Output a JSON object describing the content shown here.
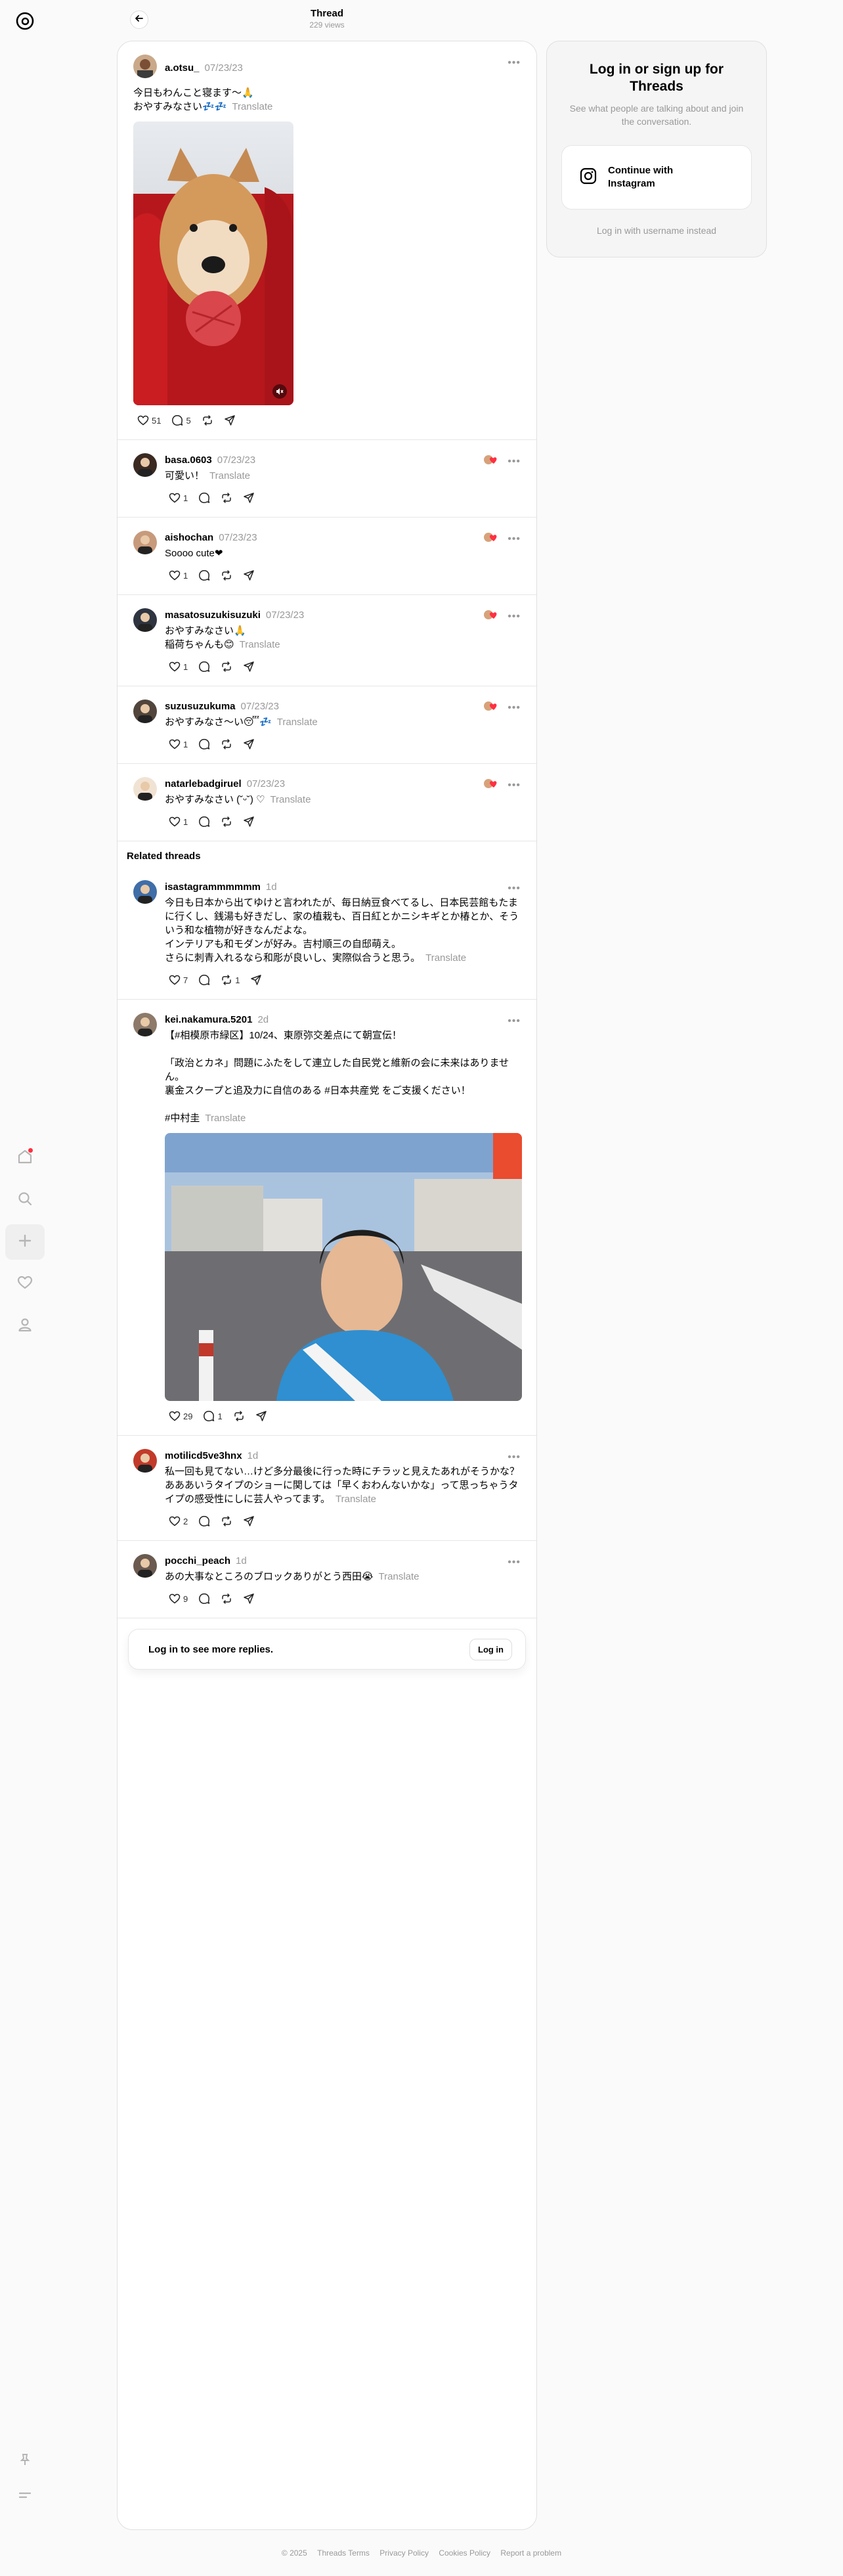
{
  "header": {
    "title": "Thread",
    "views": "229 views"
  },
  "colors": {
    "accent_red": "#ff3040",
    "muted": "#999999",
    "primary_text": "#000000"
  },
  "nav": {
    "icons": [
      "threads-logo-icon",
      "home-icon",
      "search-icon",
      "create-icon",
      "heart-icon",
      "profile-icon",
      "pin-icon",
      "menu-icon"
    ]
  },
  "main_post": {
    "username": "a.otsu_",
    "time": "07/23/23",
    "text": "今日もわんこと寝ます〜🙏\nおやすみなさい💤💤",
    "translate": "Translate",
    "likes": "51",
    "replies": "5"
  },
  "replies": [
    {
      "username": "basa.0603",
      "time": "07/23/23",
      "text": "可愛い！",
      "translate": "Translate",
      "likes": "1"
    },
    {
      "username": "aishochan",
      "time": "07/23/23",
      "text": "Soooo cute❤",
      "translate": "",
      "likes": "1"
    },
    {
      "username": "masatosuzukisuzuki",
      "time": "07/23/23",
      "text": "おやすみなさい🙏\n稲荷ちゃんも😊",
      "translate": "Translate",
      "likes": "1"
    },
    {
      "username": "suzusuzukuma",
      "time": "07/23/23",
      "text": "おやすみなさ〜い😴💤",
      "translate": "Translate",
      "likes": "1"
    },
    {
      "username": "natarlebadgiruel",
      "time": "07/23/23",
      "text": "おやすみなさい (˘ᵕ˘) ♡",
      "translate": "Translate",
      "likes": "1"
    }
  ],
  "related": {
    "heading": "Related threads",
    "items": [
      {
        "username": "isastagrammmmmm",
        "time": "1d",
        "text": "今日も日本から出てゆけと言われたが、毎日納豆食べてるし、日本民芸館もたまに行くし、銭湯も好きだし、家の植栽も、百日紅とかニシキギとか椿とか、そういう和な植物が好きなんだよな。\nインテリアも和モダンが好み。吉村順三の自邸萌え。\nさらに刺青入れるなら和彫が良いし、実際似合うと思う。",
        "translate": "Translate",
        "likes": "7",
        "reposts": "1"
      },
      {
        "username": "kei.nakamura.5201",
        "time": "2d",
        "text": "【#相模原市緑区】10/24、東原弥交差点にて朝宣伝！\n\n「政治とカネ」問題にふたをして連立した自民党と維新の会に未来はありません。\n裏金スクープと追及力に自信のある #日本共産党 をご支援ください！\n\n#中村圭",
        "translate": "Translate",
        "likes": "29",
        "replies": "1"
      },
      {
        "username": "motilicd5ve3hnx",
        "time": "1d",
        "text": "私一回も見てない…けど多分最後に行った時にチラッと見えたあれがそうかな？あああいうタイプのショーに関しては「早くおわんないかな」って思っちゃうタイプの感受性にしに芸人やってます。",
        "translate": "Translate",
        "likes": "2"
      },
      {
        "username": "pocchi_peach",
        "time": "1d",
        "text": "あの大事なところのブロックありがとう西田😭",
        "translate": "Translate",
        "likes": "9"
      }
    ]
  },
  "login_prompt": {
    "text": "Log in to see more replies.",
    "button": "Log in"
  },
  "side_panel": {
    "title": "Log in or sign up for Threads",
    "subtitle": "See what people are talking about and join the conversation.",
    "instagram_button": "Continue with Instagram",
    "alt_link": "Log in with username instead"
  },
  "footer": {
    "links": [
      "© 2025",
      "Threads Terms",
      "Privacy Policy",
      "Cookies Policy",
      "Report a problem"
    ]
  }
}
